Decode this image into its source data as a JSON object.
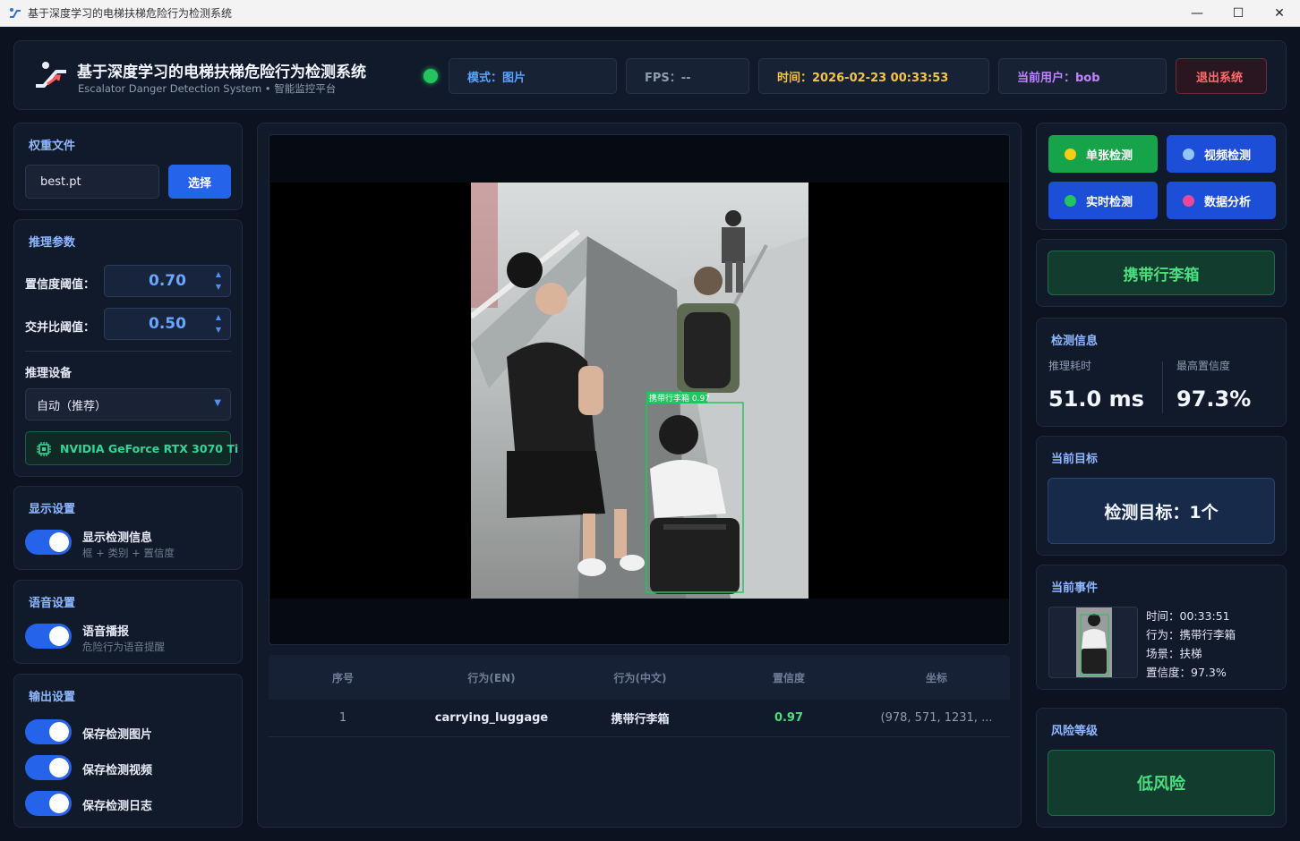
{
  "window": {
    "title": "基于深度学习的电梯扶梯危险行为检测系统",
    "minimize": "—",
    "maximize": "☐",
    "close": "✕"
  },
  "header": {
    "title": "基于深度学习的电梯扶梯危险行为检测系统",
    "subtitle": "Escalator Danger Detection System • 智能监控平台",
    "mode": "模式：图片",
    "fps": "FPS：--",
    "time": "时间：2026-02-23 00:33:53",
    "user": "当前用户：bob",
    "logout": "退出系统"
  },
  "weights": {
    "title": "权重文件",
    "file": "best.pt",
    "choose": "选择"
  },
  "inference": {
    "title": "推理参数",
    "conf_label": "置信度阈值：",
    "conf_value": "0.70",
    "iou_label": "交并比阈值：",
    "iou_value": "0.50",
    "device_label": "推理设备",
    "device_value": "自动（推荐）",
    "gpu": "NVIDIA GeForce RTX 3070 Ti"
  },
  "display": {
    "title": "显示设置",
    "label": "显示检测信息",
    "sub": "框 + 类别 + 置信度"
  },
  "voice": {
    "title": "语音设置",
    "label": "语音播报",
    "sub": "危险行为语音提醒"
  },
  "output": {
    "title": "输出设置",
    "save_image": "保存检测图片",
    "save_video": "保存检测视频",
    "save_log": "保存检测日志"
  },
  "viewer": {
    "detection_label": "携带行李箱 0.97"
  },
  "table": {
    "headers": [
      "序号",
      "行为(EN)",
      "行为(中文)",
      "置信度",
      "坐标"
    ],
    "rows": [
      [
        "1",
        "carrying_luggage",
        "携带行李箱",
        "0.97",
        "(978, 571, 1231, ..."
      ]
    ]
  },
  "modes": {
    "single": "单张检测",
    "video": "视频检测",
    "realtime": "实时检测",
    "analysis": "数据分析"
  },
  "current_behavior": "携带行李箱",
  "detection_info": {
    "title": "检测信息",
    "time_label": "推理耗时",
    "time_value": "51.0 ms",
    "conf_label": "最高置信度",
    "conf_value": "97.3%"
  },
  "target": {
    "title": "当前目标",
    "value": "检测目标：1个"
  },
  "event": {
    "title": "当前事件",
    "time": "时间：00:33:51",
    "behavior": "行为：携带行李箱",
    "scene": "场景：扶梯",
    "conf": "置信度：97.3%"
  },
  "risk": {
    "title": "风险等级",
    "value": "低风险"
  },
  "colors": {
    "accent": "#2563eb",
    "success": "#22c55e",
    "warning": "#f5c542",
    "danger": "#ff6b6b"
  }
}
